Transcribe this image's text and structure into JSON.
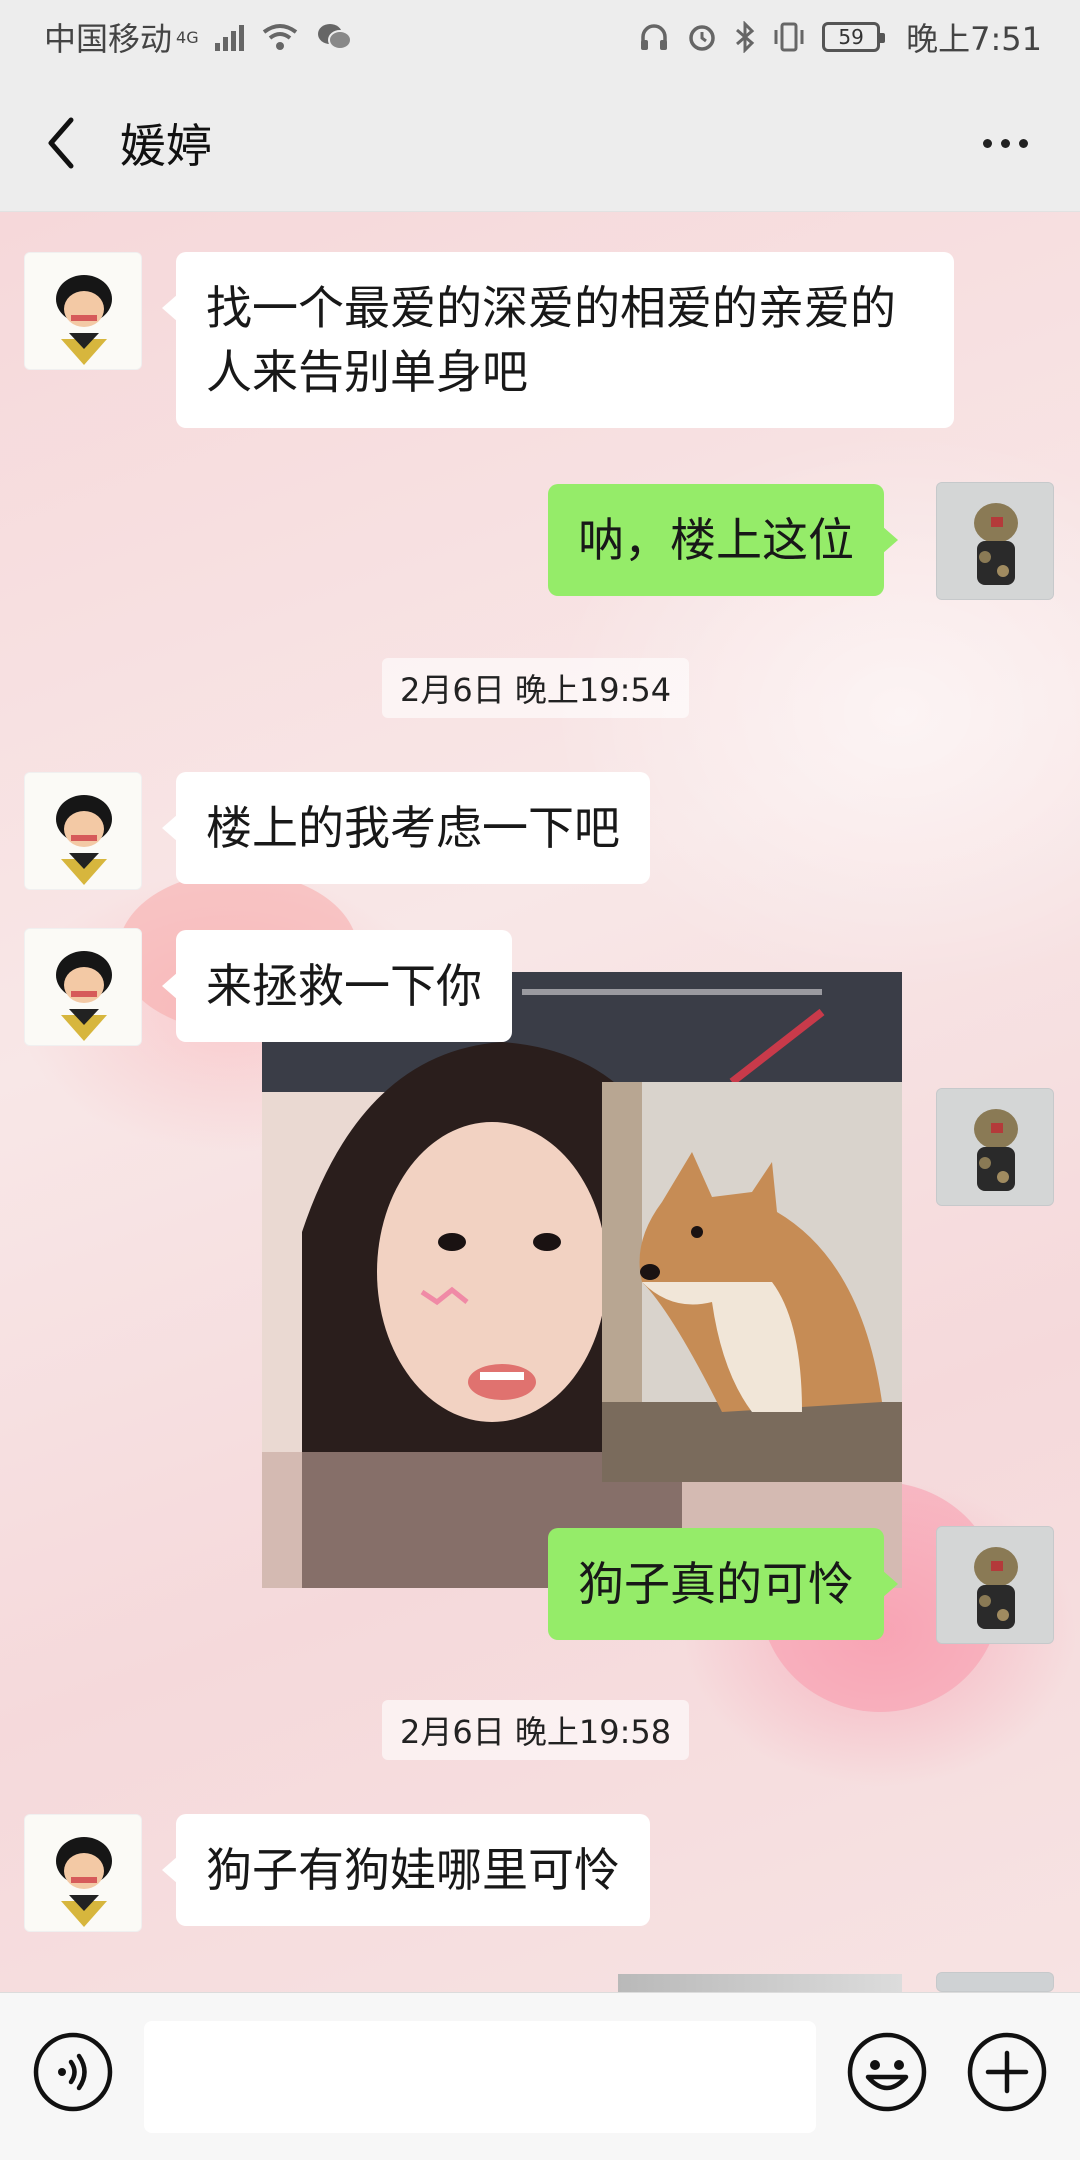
{
  "status_bar": {
    "carrier": "中国移动",
    "network": "4G",
    "battery": "59",
    "time": "晚上7:51"
  },
  "header": {
    "title": "媛婷",
    "back_icon": "chevron-left-icon",
    "more_icon": "more-dots-icon"
  },
  "messages": [
    {
      "side": "in",
      "text": "找一个最爱的深爱的相爱的亲爱的人来告别单身吧"
    },
    {
      "side": "out",
      "text": "呐，楼上这位"
    },
    {
      "type": "time",
      "text": "2月6日 晚上19:54"
    },
    {
      "side": "in",
      "text": "楼上的我考虑一下吧"
    },
    {
      "side": "in",
      "text": "来拯救一下你"
    },
    {
      "side": "out",
      "type": "image",
      "content": "selfie-with-shiba-collage"
    },
    {
      "side": "out",
      "text": "狗子真的可怜"
    },
    {
      "type": "time",
      "text": "2月6日 晚上19:58"
    },
    {
      "side": "in",
      "text": "狗子有狗娃哪里可怜"
    }
  ],
  "input_bar": {
    "voice_icon": "voice-icon",
    "input_value": "",
    "emoji_icon": "emoji-icon",
    "plus_icon": "plus-icon"
  },
  "colors": {
    "bubble_out": "#95ec69",
    "bubble_in": "#ffffff",
    "bar_bg": "#ededed"
  }
}
